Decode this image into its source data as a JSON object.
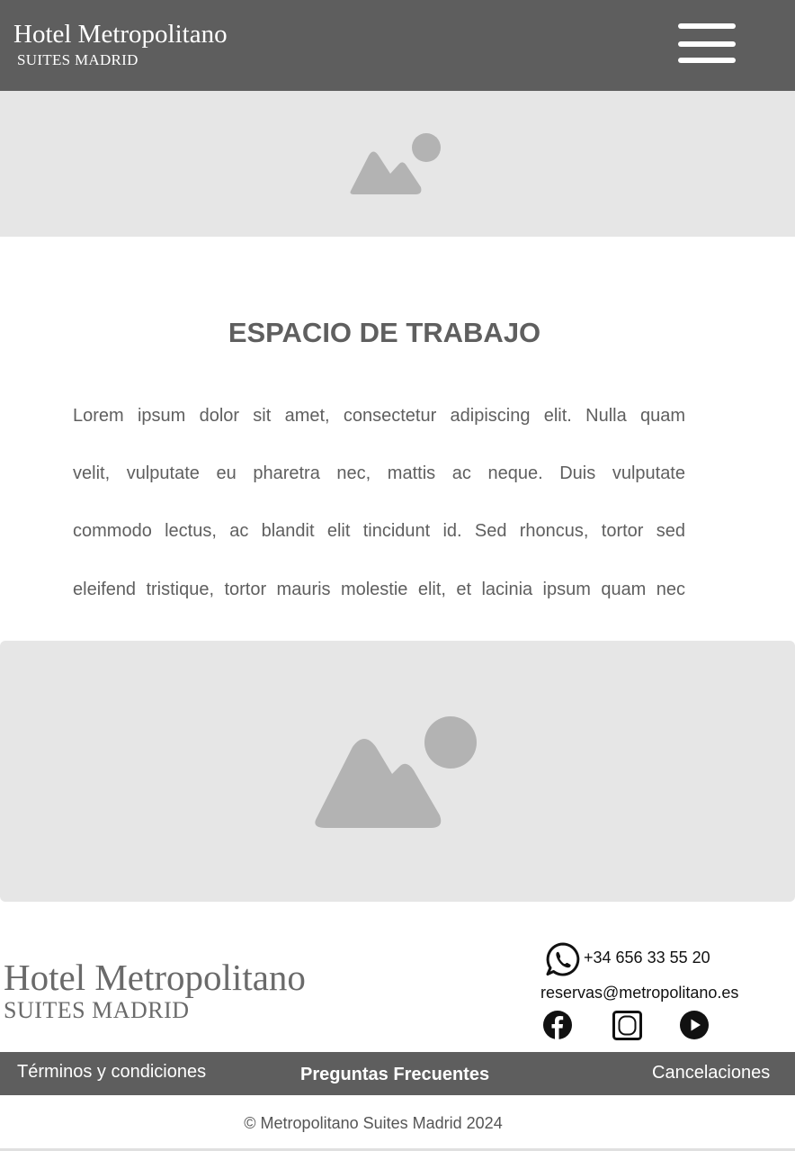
{
  "header": {
    "brand_title": "Hotel Metropolitano",
    "brand_subtitle": "SUITES MADRID",
    "menu_icon": "hamburger-menu-icon"
  },
  "hero": {
    "icon": "image-placeholder-icon"
  },
  "content": {
    "title": "ESPACIO DE TRABAJO",
    "paragraph_lines": [
      "Lorem ipsum dolor sit amet, consectetur adipiscing elit. Nulla quam",
      "velit, vulputate eu pharetra nec, mattis ac neque. Duis vulputate",
      "commodo lectus, ac blandit elit tincidunt id. Sed rhoncus, tortor sed",
      "eleifend tristique, tortor mauris molestie elit, et lacinia ipsum quam nec"
    ]
  },
  "gallery": {
    "icon": "image-placeholder-icon"
  },
  "footer": {
    "brand_title": "Hotel Metropolitano",
    "brand_subtitle": "SUITES MADRID",
    "phone": "+34 656 33 55 20",
    "email": "reservas@metropolitano.es",
    "social_icons": [
      "whatsapp-icon",
      "facebook-icon",
      "instagram-icon",
      "youtube-icon"
    ],
    "links": {
      "terms": "Términos y condiciones",
      "faq": "Preguntas Frecuentes",
      "cancellations": "Cancelaciones"
    },
    "copyright": "© Metropolitano Suites Madrid 2024"
  },
  "colors": {
    "header_bg": "#5e5e5e",
    "placeholder_bg": "#e6e6e6",
    "placeholder_icon": "#b3b3b3",
    "text_gray": "#5f5f5f"
  }
}
